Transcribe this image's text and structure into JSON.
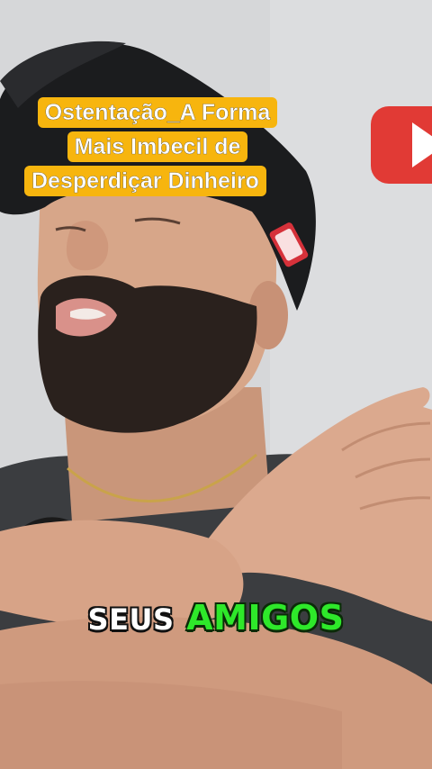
{
  "video": {
    "title_lines": [
      "Ostentação_A Forma",
      "Mais Imbecil de",
      "Desperdiçar Dinheiro"
    ],
    "caption_word_1": "SEUS",
    "caption_word_2": "AMIGOS"
  },
  "colors": {
    "title_bg": "#f7b50e",
    "caption_highlight": "#2ee82a",
    "youtube_red": "#e52d27"
  },
  "icons": [
    "youtube-play-icon"
  ]
}
